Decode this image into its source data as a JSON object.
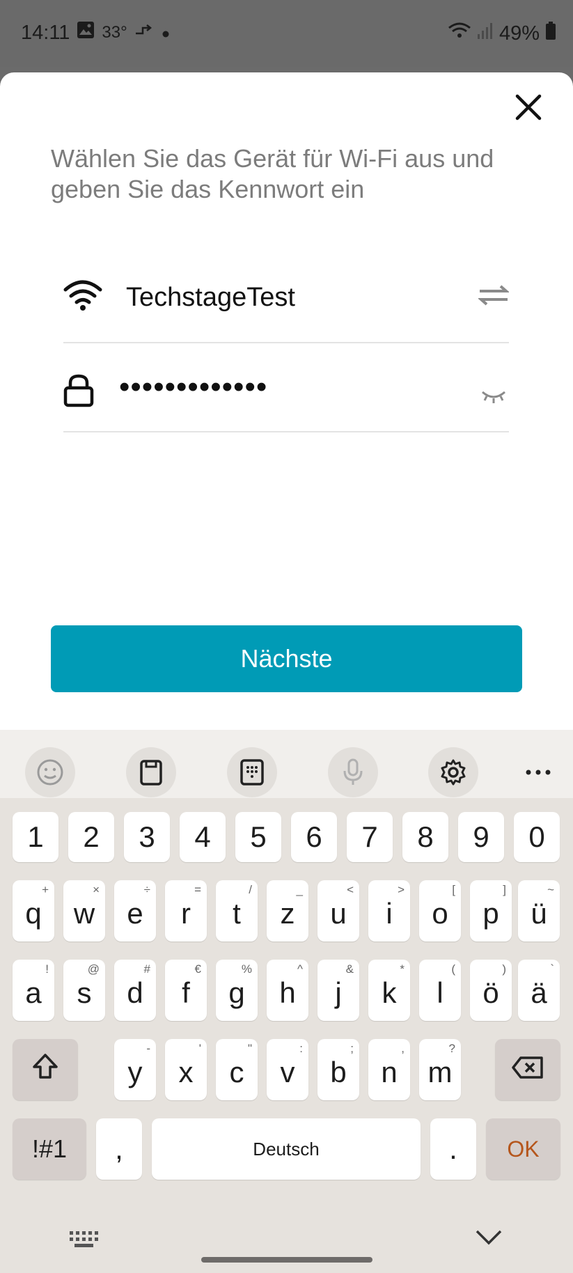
{
  "status_bar": {
    "time": "14:11",
    "temperature": "33°",
    "battery": "49%",
    "icons": [
      "gallery-icon",
      "call-forward-icon",
      "dot-icon",
      "wifi-data-icon",
      "signal-icon",
      "battery-icon"
    ]
  },
  "dialog": {
    "instruction": "Wählen Sie das Gerät für Wi-Fi aus und geben Sie das Kennwort ein",
    "ssid": "TechstageTest",
    "password_masked": "•••••••••••••",
    "next_label": "Nächste",
    "accent_color": "#009bb6"
  },
  "keyboard": {
    "toolbar_icons": [
      "emoji-icon",
      "clipboard-icon",
      "keypad-icon",
      "microphone-icon",
      "settings-icon",
      "more-icon"
    ],
    "row_numbers": [
      "1",
      "2",
      "3",
      "4",
      "5",
      "6",
      "7",
      "8",
      "9",
      "0"
    ],
    "row1": {
      "keys": [
        "q",
        "w",
        "e",
        "r",
        "t",
        "z",
        "u",
        "i",
        "o",
        "p",
        "ü"
      ],
      "hints": [
        "+",
        "×",
        "÷",
        "=",
        "/",
        "_",
        "<",
        ">",
        "[",
        "]",
        "~"
      ]
    },
    "row2": {
      "keys": [
        "a",
        "s",
        "d",
        "f",
        "g",
        "h",
        "j",
        "k",
        "l",
        "ö",
        "ä"
      ],
      "hints": [
        "!",
        "@",
        "#",
        "€",
        "%",
        "^",
        "&",
        "*",
        "(",
        ")",
        "`"
      ]
    },
    "row3": {
      "keys": [
        "y",
        "x",
        "c",
        "v",
        "b",
        "n",
        "m"
      ],
      "hints": [
        "-",
        "'",
        "\"",
        ":",
        ";",
        ",",
        "?"
      ]
    },
    "symbols_label": "!#1",
    "comma_label": ",",
    "space_label": "Deutsch",
    "period_label": ".",
    "ok_label": "OK",
    "ok_color": "#b5561c"
  }
}
